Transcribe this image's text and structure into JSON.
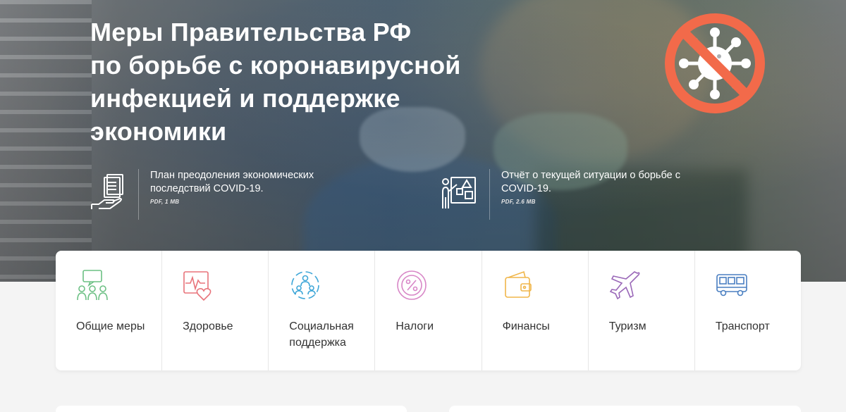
{
  "hero": {
    "title_lines": [
      "Меры Правительства РФ",
      "по борьбе с коронавирусной",
      "инфекцией и поддержке",
      "экономики"
    ],
    "badge_icon": "no-virus-icon",
    "badge_color": "#f26a4a"
  },
  "documents": [
    {
      "title": "План преодоления экономических последствий COVID-19.",
      "meta": "PDF, 1 MB",
      "icon": "document-hand-icon"
    },
    {
      "title": "Отчёт о текущей ситуации о борьбе с COVID-19.",
      "meta": "PDF, 2.6 MB",
      "icon": "presentation-icon"
    }
  ],
  "categories": [
    {
      "label": "Общие меры",
      "icon": "people-meeting-icon",
      "color": "#6cc084"
    },
    {
      "label": "Здоровье",
      "icon": "heart-monitor-icon",
      "color": "#e8737a"
    },
    {
      "label": "Социальная поддержка",
      "icon": "social-circle-icon",
      "color": "#3fa7d8"
    },
    {
      "label": "Налоги",
      "icon": "percent-icon",
      "color": "#d887c7"
    },
    {
      "label": "Финансы",
      "icon": "wallet-icon",
      "color": "#f0b64a"
    },
    {
      "label": "Туризм",
      "icon": "airplane-icon",
      "color": "#9a68b8"
    },
    {
      "label": "Транспорт",
      "icon": "bus-icon",
      "color": "#4a7fc1"
    }
  ]
}
